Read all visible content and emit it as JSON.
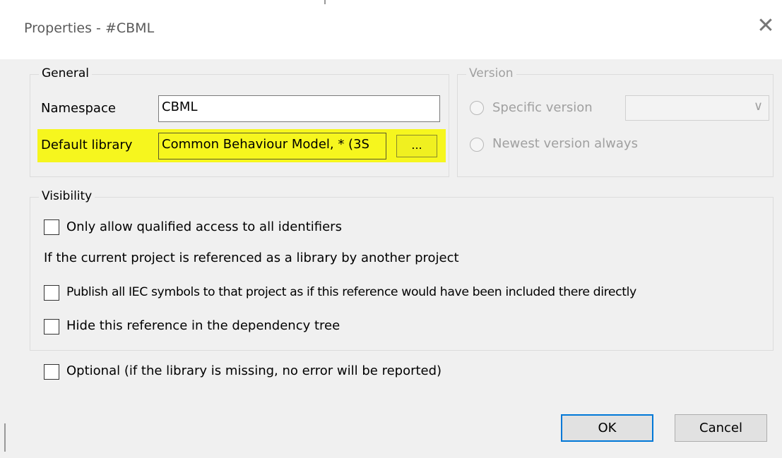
{
  "dialog": {
    "title": "Properties - #CBML",
    "close_glyph": "✕"
  },
  "general": {
    "legend": "General",
    "namespace_label": "Namespace",
    "namespace_value": "CBML",
    "default_library_label": "Default library",
    "default_library_value": "Common Behaviour Model, * (3S",
    "browse_label": "...",
    "highlight_color": "#f6f61e"
  },
  "version": {
    "legend": "Version",
    "specific_label": "Specific version",
    "newest_label": "Newest version always",
    "combo_value": "",
    "combo_arrow": "∨"
  },
  "visibility": {
    "legend": "Visibility",
    "qualified_label": "Only allow qualified access to all identifiers",
    "referenced_text": "If the current project is referenced as a library by another project",
    "publish_label": "Publish all IEC symbols to that project as if this reference would have been included there directly",
    "hide_label": "Hide this reference in the dependency tree"
  },
  "optional_label": "Optional (if the library is missing, no error will be reported)",
  "buttons": {
    "ok": "OK",
    "cancel": "Cancel",
    "accent": "#0078d7"
  }
}
